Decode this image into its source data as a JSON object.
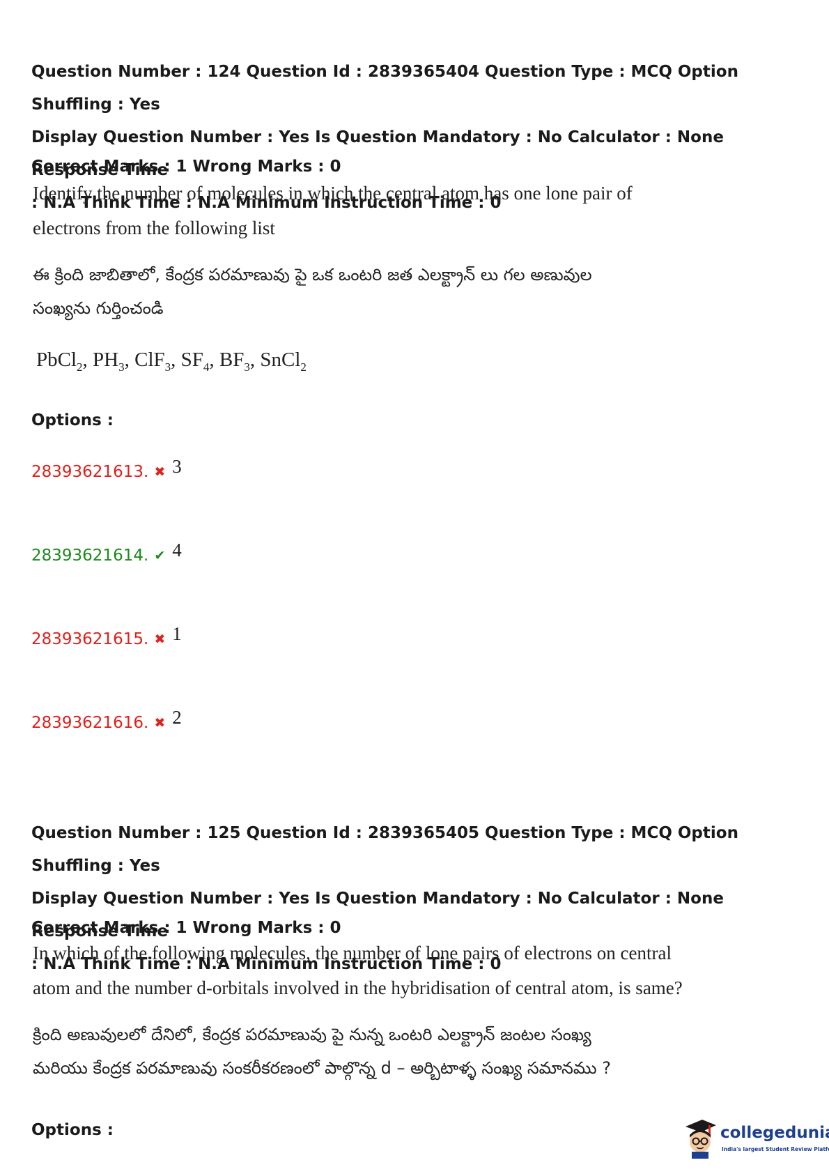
{
  "questions": [
    {
      "meta_line1": "Question Number : 124 Question Id : 2839365404 Question Type : MCQ Option Shuffling : Yes",
      "meta_line2": "Display Question Number : Yes Is Question Mandatory : No Calculator : None Response Time",
      "meta_line3": ": N.A Think Time : N.A Minimum Instruction Time : 0",
      "marks": "Correct Marks : 1 Wrong Marks : 0",
      "text_en_line1": "Identify the number of molecules in which the central atom has one lone pair of",
      "text_en_line2": "electrons from the following list",
      "text_te_line1": "ఈ క్రింది జాబితాలో, కేంద్రక పరమాణువు పై ఒక ఒంటరి జత ఎలక్ట్రాన్ లు గల అణువుల",
      "text_te_line2": "సంఖ్యను గుర్తించండి",
      "formula": {
        "f1": "PbCl",
        "s1": "2",
        "f2": ", PH",
        "s2": "3",
        "f3": ", ClF",
        "s3": "3",
        "f4": ", SF",
        "s4": "4",
        "f5": ", BF",
        "s5": "3",
        "f6": ", SnCl",
        "s6": "2"
      },
      "options_label": "Options :",
      "options": [
        {
          "id": "28393621613.",
          "value": "3",
          "status": "wrong"
        },
        {
          "id": "28393621614.",
          "value": "4",
          "status": "correct"
        },
        {
          "id": "28393621615.",
          "value": "1",
          "status": "wrong"
        },
        {
          "id": "28393621616.",
          "value": "2",
          "status": "wrong"
        }
      ]
    },
    {
      "meta_line1": "Question Number : 125 Question Id : 2839365405 Question Type : MCQ Option Shuffling : Yes",
      "meta_line2": "Display Question Number : Yes Is Question Mandatory : No Calculator : None Response Time",
      "meta_line3": ": N.A Think Time : N.A Minimum Instruction Time : 0",
      "marks": "Correct Marks : 1 Wrong Marks : 0",
      "text_en_line1": "In which of the following molecules, the number of lone pairs of electrons on central",
      "text_en_line2": "atom and the number d-orbitals involved in the hybridisation of central atom, is same?",
      "text_te_line1": "క్రింది అణువులలో దేనిలో, కేంద్రక పరమాణువు పై నున్న ఒంటరి ఎలక్ట్రాన్ జంటల సంఖ్య",
      "text_te_line2": "మరియు కేంద్రక పరమాణువు సంకరీకరణంలో పాల్గొన్న d – అర్బిటాళ్ళ సంఖ్య సమానము ?",
      "options_label": "Options :"
    }
  ],
  "icons": {
    "wrong": "cross-icon",
    "correct": "check-icon"
  },
  "colors": {
    "wrong": "#e0201b",
    "correct": "#1d8a1d",
    "brand": "#1e3f8f"
  },
  "logo": {
    "brand": "collegedunia",
    "tagline": "India's largest Student Review Platform"
  }
}
